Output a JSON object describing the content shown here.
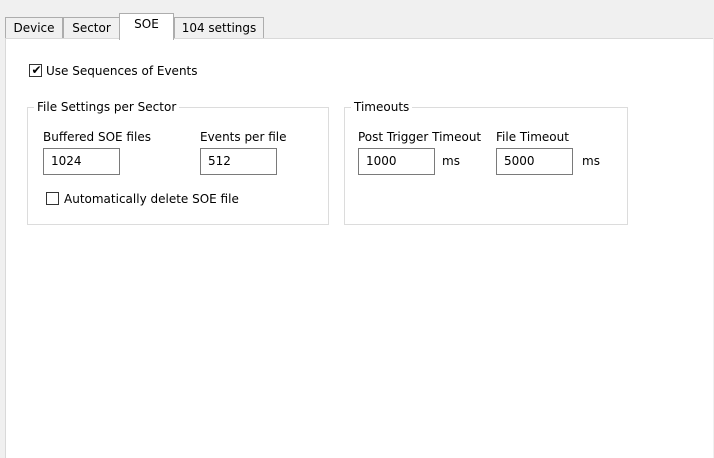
{
  "tabs": [
    {
      "label": "Device",
      "active": false
    },
    {
      "label": "Sector",
      "active": false
    },
    {
      "label": "SOE",
      "active": true
    },
    {
      "label": "104 settings",
      "active": false
    }
  ],
  "use_soe": {
    "label": "Use Sequences of Events",
    "checked": true
  },
  "file_settings": {
    "legend": "File Settings per Sector",
    "buffered_label": "Buffered SOE files",
    "buffered_value": "1024",
    "events_label": "Events per file",
    "events_value": "512",
    "auto_delete": {
      "label": "Automatically delete SOE file",
      "checked": false
    }
  },
  "timeouts": {
    "legend": "Timeouts",
    "post_trigger_label": "Post Trigger Timeout",
    "post_trigger_value": "1000",
    "post_trigger_unit": "ms",
    "file_timeout_label": "File Timeout",
    "file_timeout_value": "5000",
    "file_timeout_unit": "ms"
  },
  "check_glyph": "✔"
}
